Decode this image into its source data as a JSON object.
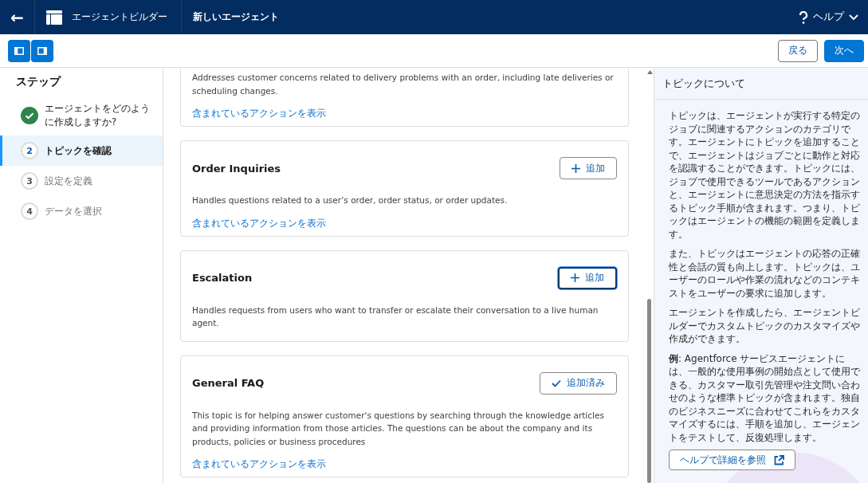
{
  "header": {
    "back": "←",
    "app_name": "エージェントビルダー",
    "page_title": "新しいエージェント",
    "help": "ヘルプ"
  },
  "toolbar": {
    "back_button": "戻る",
    "next_button": "次へ"
  },
  "steps": {
    "title": "ステップ",
    "items": [
      {
        "label": "エージェントをどのように作成しますか?",
        "completed": true,
        "selected": false
      },
      {
        "label": "トピックを確認",
        "completed": false,
        "number": "2",
        "selected": true
      },
      {
        "label": "設定を定義",
        "completed": false,
        "number": "3",
        "selected": false
      },
      {
        "label": "データを選択",
        "completed": false,
        "number": "4",
        "selected": false
      }
    ]
  },
  "topics": [
    {
      "description": "Addresses customer concerns related to delivery problems with an order, including late deliveries or scheduling changes.",
      "link": "含まれているアクションを表示"
    },
    {
      "title": "Order Inquiries",
      "description": "Handles questions related to a user’s order, order status, or order updates.",
      "link": "含まれているアクションを表示",
      "button": {
        "label": "追加",
        "added": false,
        "focused": false
      }
    },
    {
      "title": "Escalation",
      "description": "Handles requests from users who want to transfer or escalate their conversation to a live human agent.",
      "button": {
        "label": "追加",
        "added": false,
        "focused": true
      }
    },
    {
      "title": "General FAQ",
      "description": "This topic is for helping answer customer's questions by searching through the knowledge articles and providing information from those articles. The questions can be about the company and its products, policies or business procedures",
      "link": "含まれているアクションを表示",
      "button": {
        "label": "追加済み",
        "added": true,
        "focused": false
      }
    }
  ],
  "help_panel": {
    "title": "トピックについて",
    "paragraphs": [
      "トピックは、エージェントが実行する特定のジョブに関連するアクションのカテゴリです。エージェントにトピックを追加することで、エージェントはジョブごとに動作と対応を認識することができます。トピックには、ジョブで使用できるツールであるアクションと、エージェントに意思決定の方法を指示するトピック手順が含まれます。つまり、トピックはエージェントの機能の範囲を定義します。",
      "また、トピックはエージェントの応答の正確性と会話の質も向上します。トピックは、ユーザーのロールや作業の流れなどのコンテキストをユーザーの要求に追加します。",
      "エージェントを作成したら、エージェントビルダーでカスタムトピックのカスタマイズや作成ができます。",
      "**例**: Agentforce サービスエージェントには、一般的な使用事例の開始点として使用できる、カスタマー取引先管理や注文問い合わせのような標準トピックが含まれます。独自のビジネスニーズに合わせてこれらをカスタマイズするには、手順を追加し、エージェントをテストして、反復処理します。"
    ],
    "link_button": "ヘルプで詳細を参照"
  }
}
